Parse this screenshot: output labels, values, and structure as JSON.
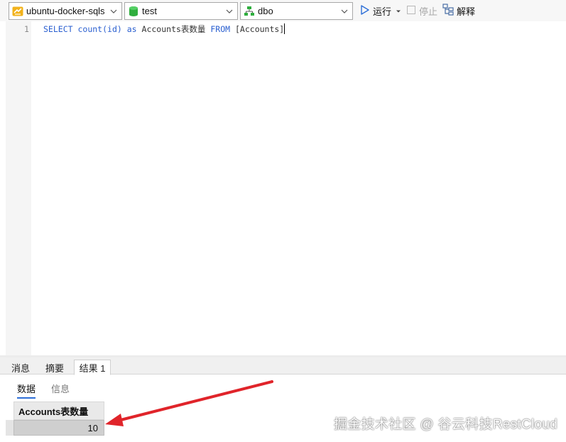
{
  "toolbar": {
    "connection": {
      "value": "ubuntu-docker-sqls",
      "icon": "connection-icon"
    },
    "database": {
      "value": "test",
      "icon": "database-icon"
    },
    "schema": {
      "value": "dbo",
      "icon": "schema-icon"
    },
    "run_label": "运行",
    "stop_label": "停止",
    "explain_label": "解释"
  },
  "editor": {
    "line_number": "1",
    "tokens": {
      "select": "SELECT",
      "func": "count(id)",
      "as": "as",
      "alias": "Accounts表数量",
      "from": "FROM",
      "table": "[Accounts]"
    }
  },
  "result_tabs": [
    "消息",
    "摘要",
    "结果 1"
  ],
  "active_result_tab": "结果 1",
  "sub_tabs": [
    "数据",
    "信息"
  ],
  "grid": {
    "columns": [
      "Accounts表数量"
    ],
    "rows": [
      [
        "10"
      ]
    ]
  },
  "watermark": "掘金技术社区 @ 谷云科技RestCloud",
  "colors": {
    "keyword": "#2a5fd0",
    "annotation_arrow": "#e0242a",
    "database_icon": "#2fae3e",
    "connection_icon": "#f2b21b",
    "run_icon": "#2e6fd8"
  }
}
